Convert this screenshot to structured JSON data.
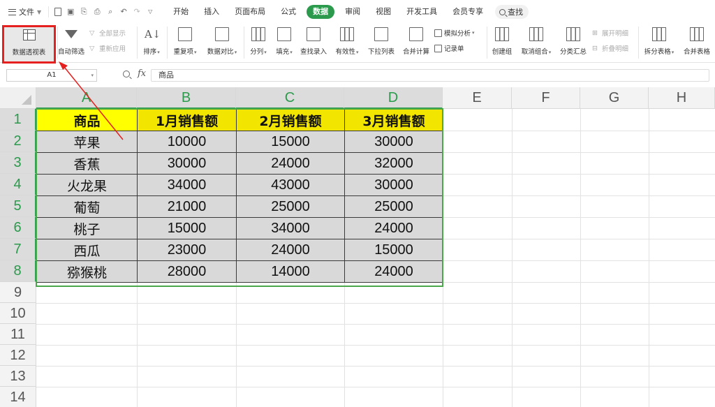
{
  "menubar": {
    "file_label": "文件",
    "tabs": [
      "开始",
      "插入",
      "页面布局",
      "公式",
      "数据",
      "审阅",
      "视图",
      "开发工具",
      "会员专享"
    ],
    "active_tab": "数据",
    "search_label": "查找"
  },
  "ribbon": {
    "pivot_table": "数据透视表",
    "auto_filter": "自动筛选",
    "show_all": "全部显示",
    "reapply": "重新应用",
    "sort": "排序",
    "duplicates": "重复项",
    "compare": "数据对比",
    "split_column": "分列",
    "fill": "填充",
    "lookup_entry": "查找录入",
    "validity": "有效性",
    "dropdown_list": "下拉列表",
    "consolidate": "合并计算",
    "what_if": "模拟分析",
    "record_form": "记录单",
    "create_group": "创建组",
    "ungroup": "取消组合",
    "subtotal": "分类汇总",
    "expand_detail": "展开明细",
    "collapse_detail": "折叠明细",
    "split_table": "拆分表格",
    "merge_table": "合并表格"
  },
  "formula_bar": {
    "cell_ref": "A1",
    "fx": "fx",
    "content": "商品"
  },
  "sheet": {
    "columns": [
      "A",
      "B",
      "C",
      "D",
      "E",
      "F",
      "G",
      "H"
    ],
    "rows": [
      "1",
      "2",
      "3",
      "4",
      "5",
      "6",
      "7",
      "8",
      "9",
      "10",
      "11",
      "12",
      "13",
      "14"
    ],
    "table": {
      "headers": [
        "商品",
        "1月销售额",
        "2月销售额",
        "3月销售额"
      ],
      "rows": [
        [
          "苹果",
          "10000",
          "15000",
          "30000"
        ],
        [
          "香蕉",
          "30000",
          "24000",
          "32000"
        ],
        [
          "火龙果",
          "34000",
          "43000",
          "30000"
        ],
        [
          "葡萄",
          "21000",
          "25000",
          "25000"
        ],
        [
          "桃子",
          "15000",
          "34000",
          "24000"
        ],
        [
          "西瓜",
          "23000",
          "24000",
          "15000"
        ],
        [
          "猕猴桃",
          "28000",
          "14000",
          "24000"
        ]
      ]
    }
  },
  "colors": {
    "accent_green": "#2c9a4d",
    "highlight_red": "#e5201f",
    "header_yellow": "#ffff00"
  }
}
